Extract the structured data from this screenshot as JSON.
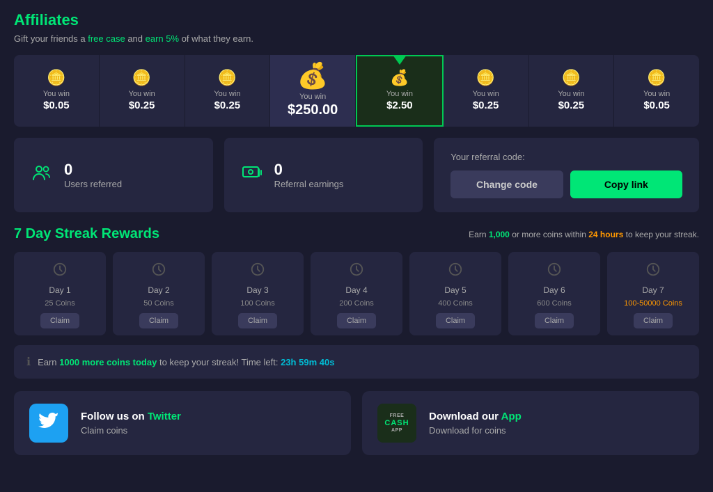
{
  "page": {
    "title": "Affiliates",
    "subtitle_prefix": "Gift your friends a ",
    "subtitle_free": "free case",
    "subtitle_mid": " and ",
    "subtitle_earn": "earn 5%",
    "subtitle_suffix": " of what they earn."
  },
  "prizes": [
    {
      "id": 1,
      "icon": "🪙",
      "label": "You win",
      "amount": "$0.05",
      "state": "normal"
    },
    {
      "id": 2,
      "icon": "🪙",
      "label": "You win",
      "amount": "$0.25",
      "state": "normal"
    },
    {
      "id": 3,
      "icon": "🪙",
      "label": "You win",
      "amount": "$0.25",
      "state": "normal"
    },
    {
      "id": 4,
      "icon": "💰",
      "label": "You win",
      "amount": "$250.00",
      "state": "highlighted"
    },
    {
      "id": 5,
      "icon": "💰",
      "label": "You win",
      "amount": "$2.50",
      "state": "active"
    },
    {
      "id": 6,
      "icon": "🪙",
      "label": "You win",
      "amount": "$0.25",
      "state": "normal"
    },
    {
      "id": 7,
      "icon": "🪙",
      "label": "You win",
      "amount": "$0.25",
      "state": "normal"
    },
    {
      "id": 8,
      "icon": "🪙",
      "label": "You win",
      "amount": "$0.05",
      "state": "normal"
    }
  ],
  "stats": {
    "users_referred": {
      "count": "0",
      "label": "Users referred"
    },
    "referral_earnings": {
      "count": "0",
      "label": "Referral earnings"
    }
  },
  "referral": {
    "label": "Your referral code:",
    "change_code_btn": "Change code",
    "copy_link_btn": "Copy link"
  },
  "streak": {
    "title": "7 Day Streak Rewards",
    "hint_prefix": "Earn ",
    "hint_num": "1,000",
    "hint_mid": " or more coins within ",
    "hint_time": "24 hours",
    "hint_suffix": " to keep your streak.",
    "days": [
      {
        "label": "Day 1",
        "coins": "25 Coins",
        "special": false
      },
      {
        "label": "Day 2",
        "coins": "50 Coins",
        "special": false
      },
      {
        "label": "Day 3",
        "coins": "100 Coins",
        "special": false
      },
      {
        "label": "Day 4",
        "coins": "200 Coins",
        "special": false
      },
      {
        "label": "Day 5",
        "coins": "400 Coins",
        "special": false
      },
      {
        "label": "Day 6",
        "coins": "600 Coins",
        "special": false
      },
      {
        "label": "Day 7",
        "coins": "100-50000 Coins",
        "special": true
      }
    ],
    "claim_btn": "Claim",
    "info_bar": {
      "prefix": "Earn ",
      "earn_hl": "1000 more coins today",
      "mid": " to keep your streak! Time left: ",
      "time_hl": "23h 59m 40s"
    }
  },
  "footer": {
    "twitter": {
      "main_label_prefix": "Follow us on ",
      "main_label_hl": "Twitter",
      "sub_label": "Claim coins"
    },
    "app": {
      "main_label_prefix": "Download our ",
      "main_label_hl": "App",
      "sub_label": "Download for coins",
      "badge_top": "FREE",
      "badge_mid": "CASH",
      "badge_bot": "APP"
    }
  }
}
